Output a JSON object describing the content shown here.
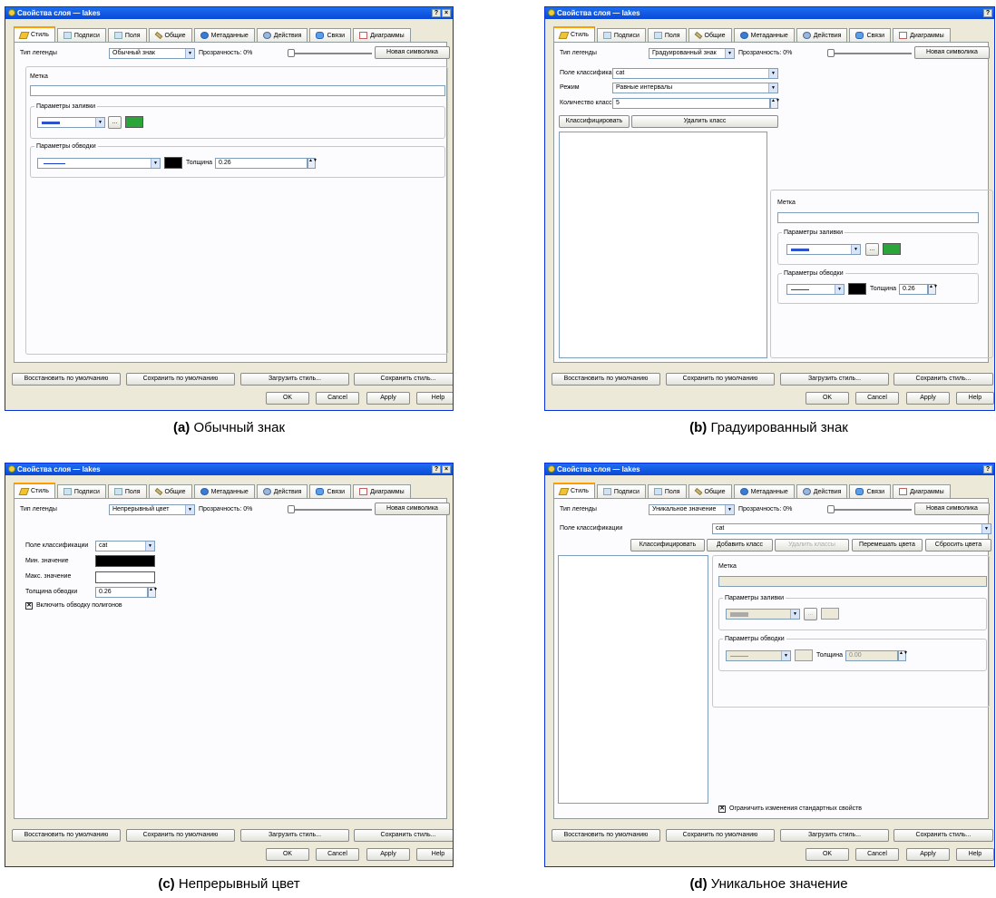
{
  "window_title": "Свойства слоя — lakes",
  "title_buttons": [
    "?",
    "×"
  ],
  "tabs": [
    "Стиль",
    "Подписи",
    "Поля",
    "Общие",
    "Метаданные",
    "Действия",
    "Связи",
    "Диаграммы"
  ],
  "common": {
    "legend_type_label": "Тип легенды",
    "transparency_label": "Прозрачность: 0%",
    "transparency_value": 0,
    "new_symbology": "Новая символика",
    "restore_default": "Восстановить по умолчанию",
    "save_default": "Сохранить по умолчанию",
    "load_style": "Загрузить стиль...",
    "save_style": "Сохранить стиль...",
    "ok": "OK",
    "cancel": "Cancel",
    "apply": "Apply",
    "help": "Help",
    "label_label": "Метка",
    "fill_group": "Параметры заливки",
    "outline_group": "Параметры обводки",
    "thickness_label": "Толщина",
    "more": "..."
  },
  "panel_a": {
    "legend_type": "Обычный знак",
    "thickness": "0.26",
    "fill_color": "#2e52c9",
    "secondary_color": "#2aa53a",
    "outline_color": "#000000"
  },
  "panel_b": {
    "legend_type": "Градуированный знак",
    "class_field_label": "Поле классификации",
    "class_field": "cat",
    "mode_label": "Режим",
    "mode": "Равные интервалы",
    "classes_label": "Количество классов",
    "classes": "5",
    "classify": "Классифицировать",
    "delete_class": "Удалить класс",
    "thickness": "0.26"
  },
  "panel_c": {
    "legend_type": "Непрерывный цвет",
    "class_field_label": "Поле классификации",
    "class_field": "cat",
    "min_label": "Мин. значение",
    "max_label": "Макс. значение",
    "outline_label": "Толщина обводки",
    "outline_value": "0.26",
    "polygon_outline": "Включить обводку полигонов",
    "min_color": "#000000",
    "max_color": "#ffffff"
  },
  "panel_d": {
    "legend_type": "Уникальное значение",
    "class_field_label": "Поле классификации",
    "class_field": "cat",
    "classify": "Классифицировать",
    "add_class": "Добавить класс",
    "delete_classes": "Удалить классы",
    "shuffle_colors": "Перемешать цвета",
    "reset_colors": "Сбросить цвета",
    "thickness": "0.00",
    "restrict": "Ограничить изменения стандартных свойств"
  },
  "captions": [
    {
      "letter": "(a)",
      "text": "Обычный знак"
    },
    {
      "letter": "(b)",
      "text": "Градуированный знак"
    },
    {
      "letter": "(c)",
      "text": "Непрерывный цвет"
    },
    {
      "letter": "(d)",
      "text": "Уникальное значение"
    }
  ]
}
